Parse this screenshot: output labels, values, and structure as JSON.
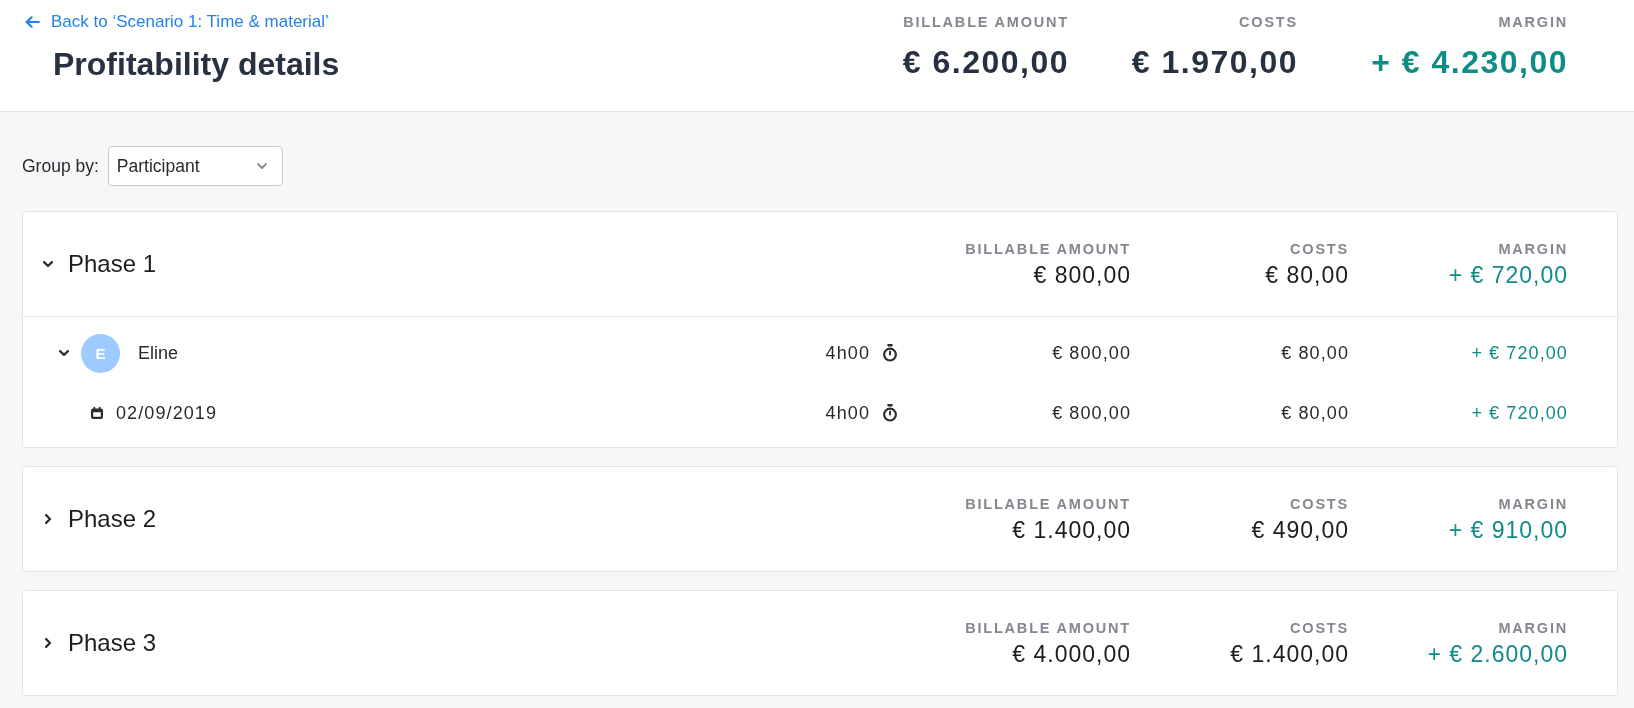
{
  "back_link": {
    "label": "Back to ‘Scenario 1: Time & material’"
  },
  "title": "Profitability details",
  "summary": [
    {
      "label": "BILLABLE AMOUNT",
      "value": "€ 6.200,00",
      "kind": "amount"
    },
    {
      "label": "COSTS",
      "value": "€ 1.970,00",
      "kind": "amount"
    },
    {
      "label": "MARGIN",
      "value": "+ € 4.230,00",
      "kind": "margin"
    }
  ],
  "group_by": {
    "label": "Group by:",
    "value": "Participant"
  },
  "phases": [
    {
      "name": "Phase 1",
      "expanded": true,
      "totals": [
        {
          "label": "BILLABLE AMOUNT",
          "value": "€ 800,00",
          "kind": "amount"
        },
        {
          "label": "COSTS",
          "value": "€ 80,00",
          "kind": "amount"
        },
        {
          "label": "MARGIN",
          "value": "+ € 720,00",
          "kind": "margin"
        }
      ],
      "participants": [
        {
          "initial": "E",
          "name": "Eline",
          "expanded": true,
          "hours": "4h00",
          "billable": "€ 800,00",
          "costs": "€ 80,00",
          "margin": "+ € 720,00",
          "entries": [
            {
              "date": "02/09/2019",
              "hours": "4h00",
              "billable": "€ 800,00",
              "costs": "€ 80,00",
              "margin": "+ € 720,00"
            }
          ]
        }
      ]
    },
    {
      "name": "Phase 2",
      "expanded": false,
      "totals": [
        {
          "label": "BILLABLE AMOUNT",
          "value": "€ 1.400,00",
          "kind": "amount"
        },
        {
          "label": "COSTS",
          "value": "€ 490,00",
          "kind": "amount"
        },
        {
          "label": "MARGIN",
          "value": "+ € 910,00",
          "kind": "margin"
        }
      ]
    },
    {
      "name": "Phase 3",
      "expanded": false,
      "totals": [
        {
          "label": "BILLABLE AMOUNT",
          "value": "€ 4.000,00",
          "kind": "amount"
        },
        {
          "label": "COSTS",
          "value": "€ 1.400,00",
          "kind": "amount"
        },
        {
          "label": "MARGIN",
          "value": "+ € 2.600,00",
          "kind": "margin"
        }
      ]
    }
  ]
}
